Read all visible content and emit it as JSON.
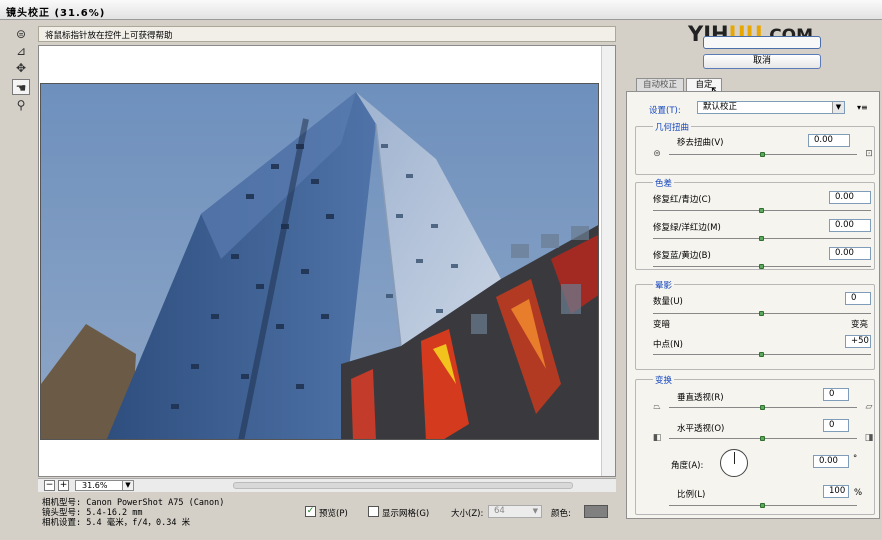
{
  "window": {
    "title": "镜头校正 (31.6%)"
  },
  "hint": {
    "text": "将鼠标指针放在控件上可获得帮助"
  },
  "toolbox": {
    "icons": [
      "distortion-tool-icon",
      "straighten-tool-icon",
      "move-grid-icon",
      "hand-tool-icon",
      "zoom-tool-icon"
    ]
  },
  "zoom": {
    "minus": "−",
    "plus": "+",
    "value": "31.6%",
    "dropdown": "▼"
  },
  "camera_info": {
    "model": "相机型号: Canon PowerShot A75 (Canon)",
    "lens": "镜头型号: 5.4-16.2 mm",
    "settings": "相机设置: 5.4 毫米，f/4，0.34 米"
  },
  "options": {
    "preview_label": "预览(P)",
    "preview_checked": "✓",
    "grid_label": "显示网格(G)",
    "size_label": "大小(Z):",
    "size_value": "64",
    "color_label": "颜色:",
    "grid_color": "#808080"
  },
  "watermark": {
    "part1": "YI",
    "part2": "H",
    "part3": "U",
    "part4": "U",
    "part5": ".COM"
  },
  "buttons": {
    "cancel": "取消"
  },
  "tabs": [
    {
      "label": "自动校正"
    },
    {
      "label": "自定"
    }
  ],
  "settings": {
    "label": "设置(T):",
    "value": "默认校正",
    "menu_icon": "▾≡"
  },
  "geometric": {
    "title": "几何扭曲",
    "remove_distortion_label": "移去扭曲(V)",
    "remove_distortion_value": "0.00",
    "remove_distortion_level": 0.5
  },
  "chromatic": {
    "title": "色差",
    "rows": [
      {
        "label": "修复红/青边(C)",
        "value": "0.00",
        "level": 0.5
      },
      {
        "label": "修复绿/洋红边(M)",
        "value": "0.00",
        "level": 0.5
      },
      {
        "label": "修复蓝/黄边(B)",
        "value": "0.00",
        "level": 0.5
      }
    ]
  },
  "vignette": {
    "title": "晕影",
    "amount_label": "数量(U)",
    "amount_value": "0",
    "amount_level": 0.5,
    "darken_label": "变暗",
    "lighten_label": "变亮",
    "midpoint_label": "中点(N)",
    "midpoint_value": "+50",
    "midpoint_level": 0.5
  },
  "transform": {
    "title": "变换",
    "vertical_label": "垂直透视(R)",
    "vertical_value": "0",
    "vertical_level": 0.5,
    "horizontal_label": "水平透视(O)",
    "horizontal_value": "0",
    "horizontal_level": 0.5,
    "angle_label": "角度(A):",
    "angle_value": "0.00",
    "angle_unit": "°",
    "scale_label": "比例(L)",
    "scale_value": "100",
    "scale_unit": "%",
    "scale_level": 0.5
  }
}
